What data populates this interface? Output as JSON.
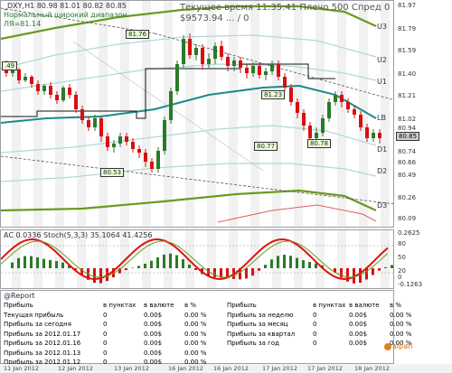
{
  "main": {
    "symbol_line": "_DXY,H1 80.98 81.01 80.82 80.85",
    "info_line1": "Нормальный широкий диапазон",
    "info_line2": "ЛЯ=81.14",
    "overlay1": "Текущее время 11:35:41 Плечо 500 Спред 0",
    "overlay2": "$9573.94 ... / 0",
    "channel_labels": [
      "U3",
      "U2",
      "U1",
      "LB",
      "D1",
      "D2",
      "D3"
    ],
    "level_labels": [
      "81.76",
      "80.53",
      "81.23",
      "80.77",
      "80.78",
      ".49"
    ],
    "price_ticks": [
      "81.97",
      "81.79",
      "81.59",
      "81.40",
      "81.21",
      "81.02",
      "80.94",
      "80.74",
      "80.66",
      "80.49",
      "80.26",
      "80.09"
    ],
    "current_price": "80.85",
    "colors": {
      "candle_up": "#2a7a2a",
      "candle_down": "#d81010",
      "channel_green": "#6a9a20",
      "lb": "#1a8a8a",
      "band_light": "#b0d8d8",
      "stripe": "#e6e6e6"
    }
  },
  "osc": {
    "title": "AC 0.0336  Stoch(5,3,3) 35.1064 41.4256",
    "ticks": [
      "0.2625",
      "80",
      "50",
      "20",
      "0",
      "-0.1263"
    ]
  },
  "report": {
    "title": "@Report",
    "left_rows": [
      [
        "Прибыль",
        "в пунктах",
        "в валюте",
        "в %"
      ],
      [
        "Текущая прибыль",
        "0",
        "0.00$",
        "0.00 %"
      ],
      [
        "Прибыль за сегодня",
        "0",
        "0.00$",
        "0.00 %"
      ],
      [
        "Прибыль за 2012.01.17",
        "0",
        "0.00$",
        "0.00 %"
      ],
      [
        "Прибыль за 2012.01.16",
        "0",
        "0.00$",
        "0.00 %"
      ],
      [
        "Прибыль за 2012.01.13",
        "0",
        "0.00$",
        "0.00 %"
      ],
      [
        "Прибыль за 2012.01.12",
        "0",
        "0.00$",
        "0.00 %"
      ]
    ],
    "right_rows": [
      [
        "Прибыль",
        "в пунктах",
        "в валюте",
        "в %"
      ],
      [
        "Прибыль за неделю",
        "0",
        "0.00$",
        "0.00 %"
      ],
      [
        "Прибыль за месяц",
        "0",
        "0.00$",
        "0.00 %"
      ],
      [
        "Прибыль за квартал",
        "0",
        "0.00$",
        "0.00 %"
      ],
      [
        "Прибыль за год",
        "0",
        "0.00$",
        "0.00 %"
      ]
    ],
    "brand": "alpari"
  },
  "timebar": {
    "labels": [
      "11 Jan 2012",
      "12 Jan 2012",
      "13 Jan 2012",
      "16 Jan 2012",
      "16 Jan 2012",
      "17 Jan 2012",
      "17 Jan 2012",
      "18 Jan 2012"
    ]
  }
}
